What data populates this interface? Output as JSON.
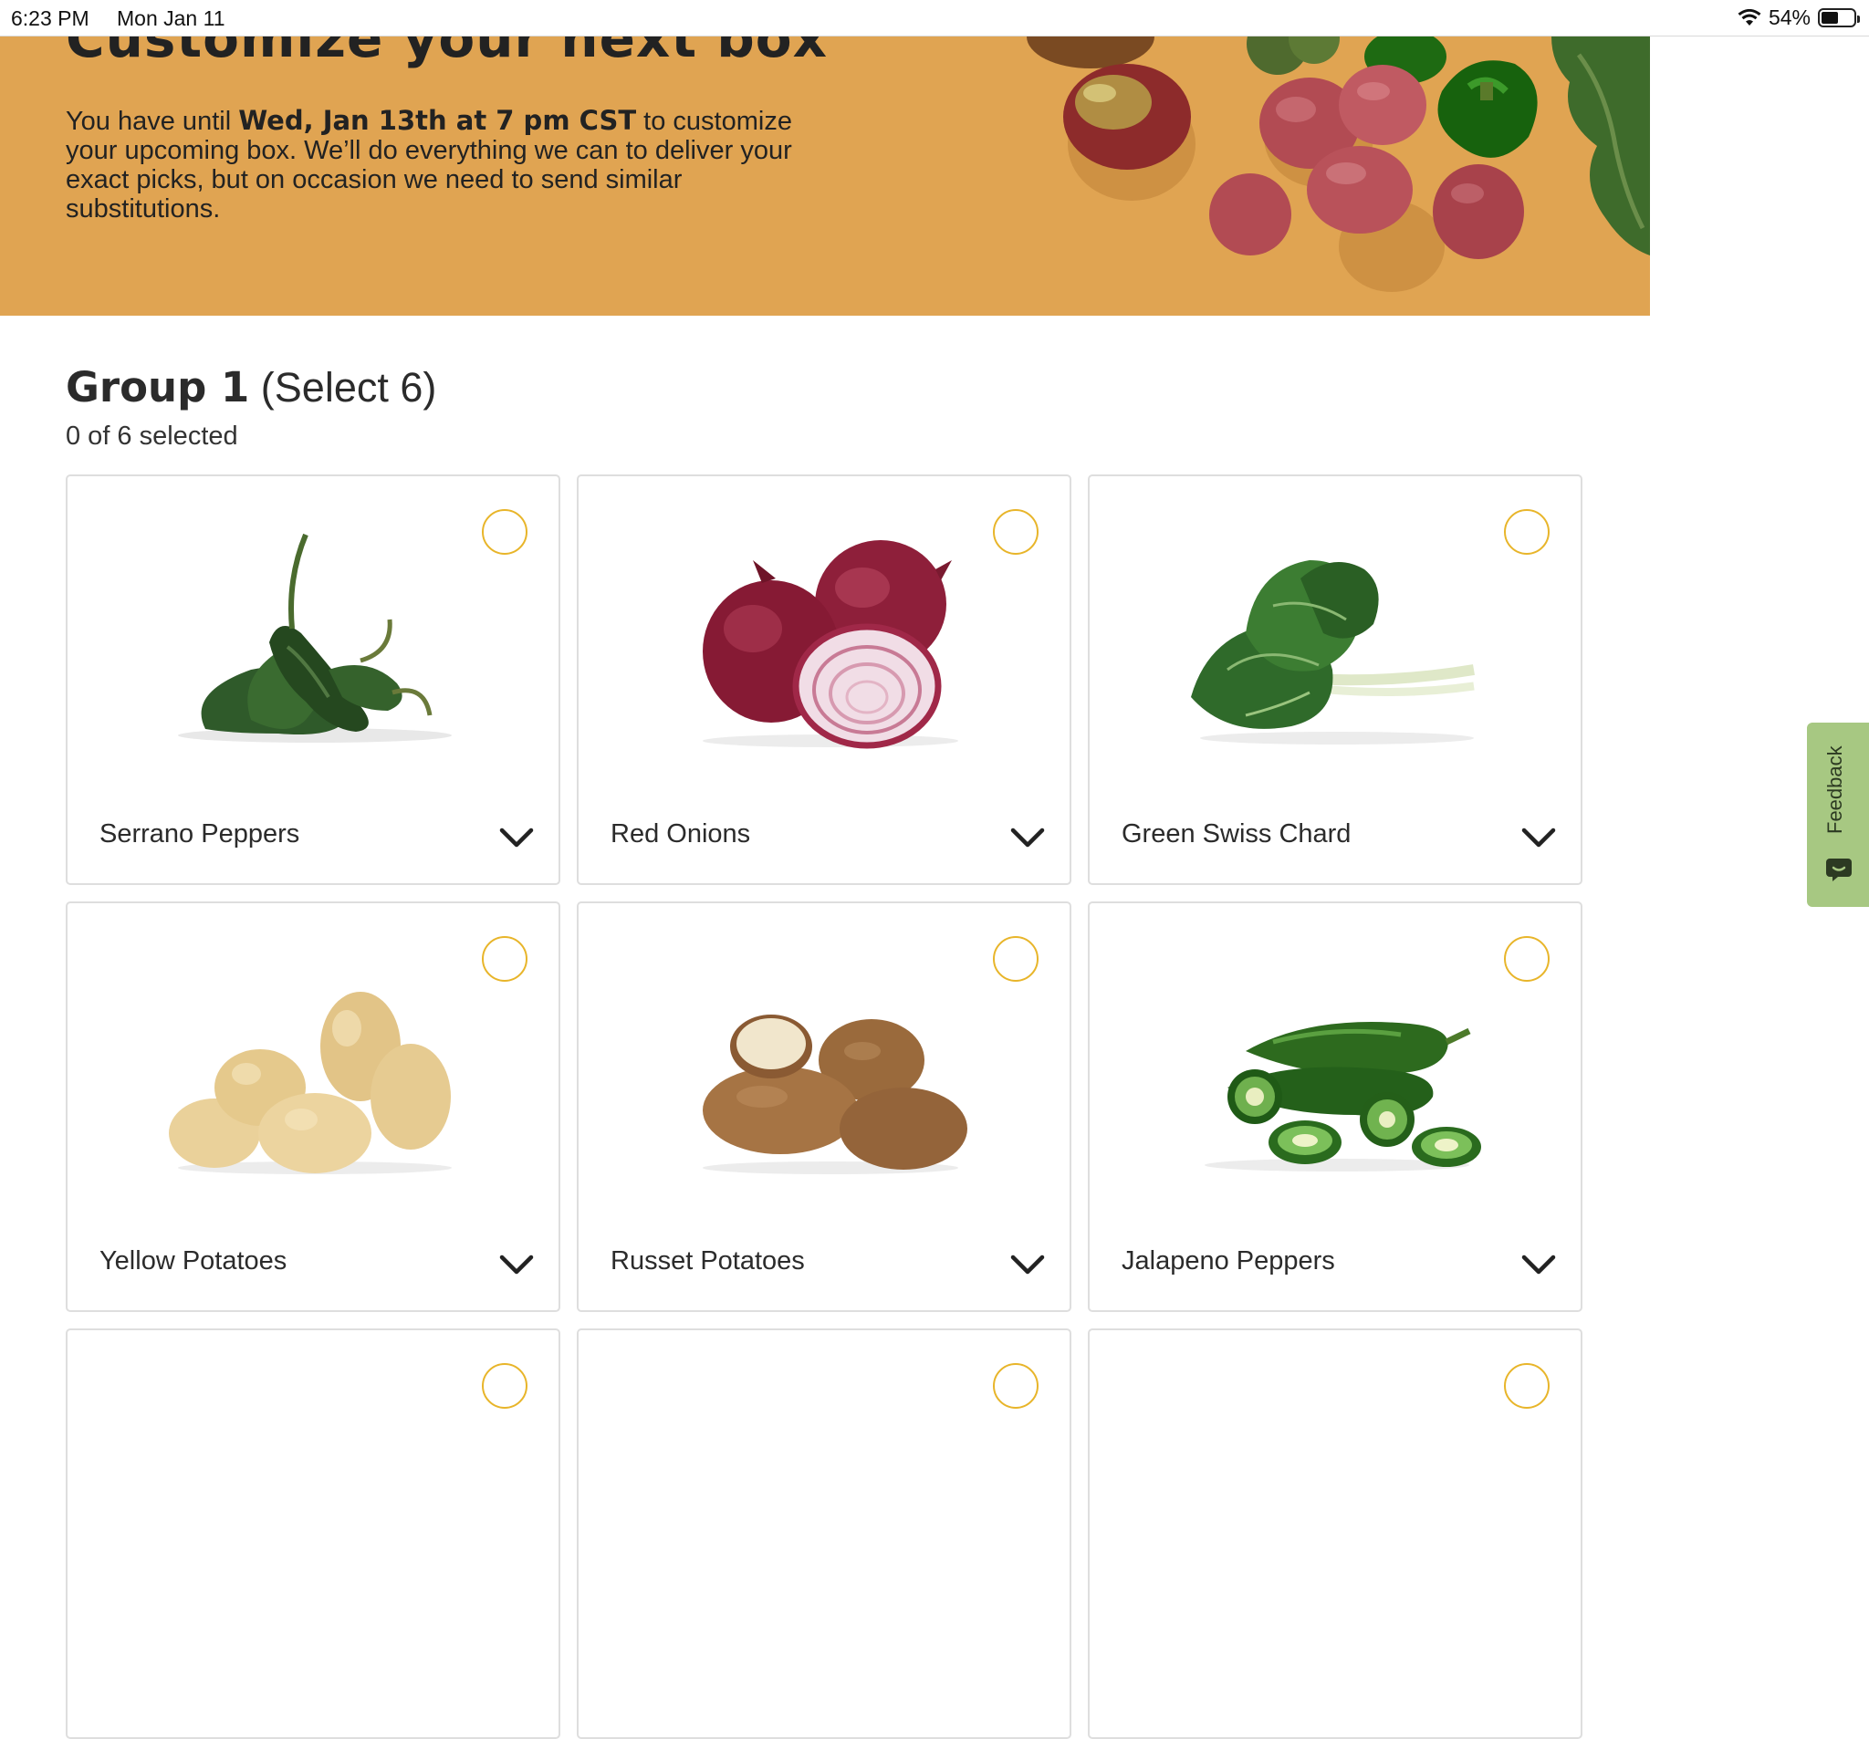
{
  "status_bar": {
    "time": "6:23 PM",
    "date": "Mon Jan 11",
    "battery": "54%",
    "battery_level": 0.54
  },
  "hero": {
    "title": "Customize your next box",
    "text_before": "You have until ",
    "deadline": "Wed, Jan 13th at 7 pm CST",
    "text_after": " to customize your upcoming box. We’ll do everything we can to deliver your exact picks, but on occasion we need to send similar substitutions."
  },
  "group": {
    "title": "Group 1",
    "subtitle": "(Select 6)",
    "count": "0 of 6 selected"
  },
  "products": [
    {
      "name": "Serrano Peppers",
      "icon": "serrano-pepper-image"
    },
    {
      "name": "Red Onions",
      "icon": "red-onion-image"
    },
    {
      "name": "Green Swiss Chard",
      "icon": "swiss-chard-image"
    },
    {
      "name": "Yellow Potatoes",
      "icon": "yellow-potato-image"
    },
    {
      "name": "Russet Potatoes",
      "icon": "russet-potato-image"
    },
    {
      "name": "Jalapeno Peppers",
      "icon": "jalapeno-pepper-image"
    }
  ],
  "feedback": {
    "label": "Feedback"
  },
  "colors": {
    "hero_bg": "#e0a452",
    "select_ring": "#e8b52a",
    "feedback_bg": "#a7c882",
    "card_border": "#dedede"
  }
}
